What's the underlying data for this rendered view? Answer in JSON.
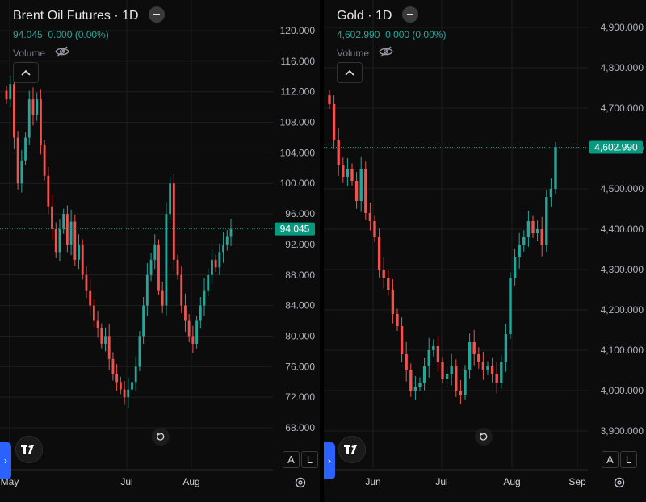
{
  "chart_data": [
    {
      "type": "candlestick",
      "title": "Brent Oil Futures · 1D",
      "last_price": "94.045",
      "change": "0.000 (0.00%)",
      "volume_label": "Volume",
      "y_ticks": [
        "120.000",
        "116.000",
        "112.000",
        "108.000",
        "104.000",
        "100.000",
        "96.000",
        "92.000",
        "88.000",
        "84.000",
        "80.000",
        "76.000",
        "72.000",
        "68.000"
      ],
      "x_ticks": [
        "May",
        "Jul",
        "Aug"
      ],
      "ylim": [
        66,
        122
      ],
      "last_value": 94.045,
      "path": [
        111,
        113,
        106,
        100,
        103,
        106,
        111,
        109,
        111,
        105,
        101,
        97,
        94,
        91,
        94,
        96,
        92,
        95,
        90,
        92,
        88,
        86,
        84,
        82,
        81,
        79,
        80,
        77,
        75,
        74,
        73,
        72,
        73,
        74,
        76,
        80,
        84,
        88,
        90,
        92,
        86,
        84,
        96,
        100,
        90,
        88,
        84,
        82,
        80,
        79,
        82,
        84,
        86,
        88,
        90,
        89,
        91,
        92,
        93,
        94.045
      ],
      "colors": {
        "up": "#26a69a",
        "down": "#ef5350",
        "grid": "#1e1e1e",
        "last_line": "#089981"
      }
    },
    {
      "type": "candlestick",
      "title": "Gold · 1D",
      "last_price": "4,602.990",
      "change": "0.000 (0.00%)",
      "volume_label": "Volume",
      "y_ticks": [
        "4,900.000",
        "4,800.000",
        "4,700.000",
        "4,600.000",
        "4,500.000",
        "4,400.000",
        "4,300.000",
        "4,200.000",
        "4,100.000",
        "4,000.000",
        "3,900.000"
      ],
      "x_ticks": [
        "Jun",
        "Jul",
        "Aug",
        "Sep"
      ],
      "ylim": [
        3860,
        4945
      ],
      "last_value": 4602.99,
      "path": [
        4710,
        4620,
        4560,
        4530,
        4550,
        4520,
        4470,
        4550,
        4440,
        4420,
        4380,
        4300,
        4280,
        4250,
        4190,
        4160,
        4090,
        4050,
        4000,
        4010,
        4020,
        4060,
        4100,
        4110,
        4070,
        4030,
        4040,
        4060,
        4000,
        3990,
        4050,
        4120,
        4090,
        4070,
        4050,
        4060,
        4040,
        4020,
        4070,
        4140,
        4280,
        4330,
        4360,
        4380,
        4420,
        4390,
        4400,
        4360,
        4480,
        4500,
        4602.99
      ],
      "colors": {
        "up": "#26a69a",
        "down": "#ef5350",
        "grid": "#1e1e1e",
        "last_line": "#089981"
      }
    }
  ],
  "controls": {
    "collapse_icon": "chevron-up-icon",
    "visibility_icon": "eye-off-icon",
    "logo": "TradingView",
    "reset_icon": "reset-icon",
    "auto_label": "A",
    "log_label": "L",
    "settings_icon": "gear-icon",
    "side_tab_glyph": "›"
  }
}
